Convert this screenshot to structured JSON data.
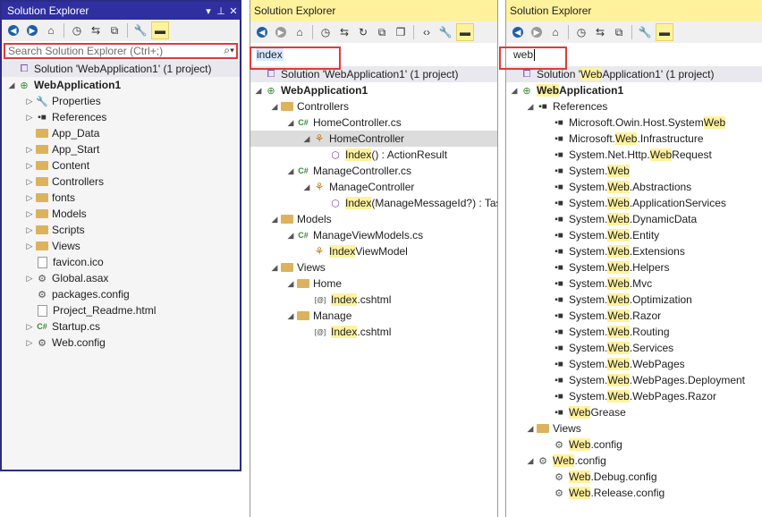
{
  "panel1": {
    "title": "Solution Explorer",
    "title_buttons": [
      "▾",
      "⊥",
      "✕"
    ],
    "search_placeholder": "Search Solution Explorer (Ctrl+;)",
    "rows": [
      {
        "t": "Solution 'WebApplication1' (1 project)",
        "icon": "solution-icon",
        "lvl": 0,
        "tri": ""
      },
      {
        "t": "WebApplication1",
        "icon": "project-icon",
        "lvl": 0,
        "tri": "◢",
        "bold": true
      },
      {
        "t": "Properties",
        "icon": "wrench-icon",
        "lvl": 1,
        "tri": "▷"
      },
      {
        "t": "References",
        "icon": "references-icon",
        "lvl": 1,
        "tri": "▷"
      },
      {
        "t": "App_Data",
        "icon": "folder-icon",
        "lvl": 1,
        "tri": ""
      },
      {
        "t": "App_Start",
        "icon": "folder-icon",
        "lvl": 1,
        "tri": "▷"
      },
      {
        "t": "Content",
        "icon": "folder-icon",
        "lvl": 1,
        "tri": "▷"
      },
      {
        "t": "Controllers",
        "icon": "folder-icon",
        "lvl": 1,
        "tri": "▷"
      },
      {
        "t": "fonts",
        "icon": "folder-icon",
        "lvl": 1,
        "tri": "▷"
      },
      {
        "t": "Models",
        "icon": "folder-icon",
        "lvl": 1,
        "tri": "▷"
      },
      {
        "t": "Scripts",
        "icon": "folder-icon",
        "lvl": 1,
        "tri": "▷"
      },
      {
        "t": "Views",
        "icon": "folder-icon",
        "lvl": 1,
        "tri": "▷"
      },
      {
        "t": "favicon.ico",
        "icon": "file-icon",
        "lvl": 1,
        "tri": ""
      },
      {
        "t": "Global.asax",
        "icon": "config-icon",
        "lvl": 1,
        "tri": "▷"
      },
      {
        "t": "packages.config",
        "icon": "config-icon",
        "lvl": 1,
        "tri": ""
      },
      {
        "t": "Project_Readme.html",
        "icon": "file-icon",
        "lvl": 1,
        "tri": ""
      },
      {
        "t": "Startup.cs",
        "icon": "csharp-icon",
        "lvl": 1,
        "tri": "▷"
      },
      {
        "t": "Web.config",
        "icon": "config-icon",
        "lvl": 1,
        "tri": "▷"
      }
    ]
  },
  "panel2": {
    "title": "Solution Explorer",
    "search_value": "index",
    "rows": [
      {
        "t": "Solution 'WebApplication1' (1 project)",
        "icon": "solution-icon",
        "lvl": 0,
        "tri": ""
      },
      {
        "t": "WebApplication1",
        "icon": "project-icon",
        "lvl": 0,
        "tri": "◢",
        "bold": true
      },
      {
        "t": "Controllers",
        "icon": "folder-icon",
        "lvl": 1,
        "tri": "◢"
      },
      {
        "t": "HomeController.cs",
        "icon": "csharp-icon",
        "lvl": 2,
        "tri": "◢"
      },
      {
        "t": "HomeController",
        "icon": "class-icon",
        "lvl": 3,
        "tri": "◢",
        "hi": true
      },
      {
        "t": "Index() : ActionResult",
        "icon": "method-icon",
        "lvl": 4,
        "tri": "",
        "hl": "Index"
      },
      {
        "t": "ManageController.cs",
        "icon": "csharp-icon",
        "lvl": 2,
        "tri": "◢"
      },
      {
        "t": "ManageController",
        "icon": "class-icon",
        "lvl": 3,
        "tri": "◢"
      },
      {
        "t": "Index(ManageMessageId?) : Task<ActionResult>",
        "icon": "method-icon",
        "lvl": 4,
        "tri": "",
        "hl": "Index"
      },
      {
        "t": "Models",
        "icon": "folder-icon",
        "lvl": 1,
        "tri": "◢"
      },
      {
        "t": "ManageViewModels.cs",
        "icon": "csharp-icon",
        "lvl": 2,
        "tri": "◢"
      },
      {
        "t": "IndexViewModel",
        "icon": "class-icon",
        "lvl": 3,
        "tri": "",
        "hl": "Index"
      },
      {
        "t": "Views",
        "icon": "folder-icon",
        "lvl": 1,
        "tri": "◢"
      },
      {
        "t": "Home",
        "icon": "folder-icon",
        "lvl": 2,
        "tri": "◢"
      },
      {
        "t": "Index.cshtml",
        "icon": "razor-icon",
        "lvl": 3,
        "tri": "",
        "hl": "Index"
      },
      {
        "t": "Manage",
        "icon": "folder-icon",
        "lvl": 2,
        "tri": "◢"
      },
      {
        "t": "Index.cshtml",
        "icon": "razor-icon",
        "lvl": 3,
        "tri": "",
        "hl": "Index"
      }
    ]
  },
  "panel3": {
    "title": "Solution Explorer",
    "search_value": "web",
    "rows": [
      {
        "t": "Solution 'WebApplication1' (1 project)",
        "icon": "solution-icon",
        "lvl": 0,
        "tri": "",
        "hl": "Web"
      },
      {
        "t": "WebApplication1",
        "icon": "project-icon",
        "lvl": 0,
        "tri": "◢",
        "bold": true,
        "hl": "Web"
      },
      {
        "t": "References",
        "icon": "references-icon",
        "lvl": 1,
        "tri": "◢"
      },
      {
        "t": "Microsoft.Owin.Host.SystemWeb",
        "icon": "assembly-icon",
        "lvl": 2,
        "tri": "",
        "hl": "Web"
      },
      {
        "t": "Microsoft.Web.Infrastructure",
        "icon": "assembly-icon",
        "lvl": 2,
        "tri": "",
        "hl": "Web"
      },
      {
        "t": "System.Net.Http.WebRequest",
        "icon": "assembly-icon",
        "lvl": 2,
        "tri": "",
        "hl": "Web"
      },
      {
        "t": "System.Web",
        "icon": "assembly-icon",
        "lvl": 2,
        "tri": "",
        "hl": "Web"
      },
      {
        "t": "System.Web.Abstractions",
        "icon": "assembly-icon",
        "lvl": 2,
        "tri": "",
        "hl": "Web"
      },
      {
        "t": "System.Web.ApplicationServices",
        "icon": "assembly-icon",
        "lvl": 2,
        "tri": "",
        "hl": "Web"
      },
      {
        "t": "System.Web.DynamicData",
        "icon": "assembly-icon",
        "lvl": 2,
        "tri": "",
        "hl": "Web"
      },
      {
        "t": "System.Web.Entity",
        "icon": "assembly-icon",
        "lvl": 2,
        "tri": "",
        "hl": "Web"
      },
      {
        "t": "System.Web.Extensions",
        "icon": "assembly-icon",
        "lvl": 2,
        "tri": "",
        "hl": "Web"
      },
      {
        "t": "System.Web.Helpers",
        "icon": "assembly-icon",
        "lvl": 2,
        "tri": "",
        "hl": "Web"
      },
      {
        "t": "System.Web.Mvc",
        "icon": "assembly-icon",
        "lvl": 2,
        "tri": "",
        "hl": "Web"
      },
      {
        "t": "System.Web.Optimization",
        "icon": "assembly-icon",
        "lvl": 2,
        "tri": "",
        "hl": "Web"
      },
      {
        "t": "System.Web.Razor",
        "icon": "assembly-icon",
        "lvl": 2,
        "tri": "",
        "hl": "Web"
      },
      {
        "t": "System.Web.Routing",
        "icon": "assembly-icon",
        "lvl": 2,
        "tri": "",
        "hl": "Web"
      },
      {
        "t": "System.Web.Services",
        "icon": "assembly-icon",
        "lvl": 2,
        "tri": "",
        "hl": "Web"
      },
      {
        "t": "System.Web.WebPages",
        "icon": "assembly-icon",
        "lvl": 2,
        "tri": "",
        "hl": "Web"
      },
      {
        "t": "System.Web.WebPages.Deployment",
        "icon": "assembly-icon",
        "lvl": 2,
        "tri": "",
        "hl": "Web"
      },
      {
        "t": "System.Web.WebPages.Razor",
        "icon": "assembly-icon",
        "lvl": 2,
        "tri": "",
        "hl": "Web"
      },
      {
        "t": "WebGrease",
        "icon": "assembly-icon",
        "lvl": 2,
        "tri": "",
        "hl": "Web"
      },
      {
        "t": "Views",
        "icon": "folder-icon",
        "lvl": 1,
        "tri": "◢"
      },
      {
        "t": "Web.config",
        "icon": "config-icon",
        "lvl": 2,
        "tri": "",
        "hl": "Web"
      },
      {
        "t": "Web.config",
        "icon": "config-icon",
        "lvl": 1,
        "tri": "◢",
        "hl": "Web"
      },
      {
        "t": "Web.Debug.config",
        "icon": "config-icon",
        "lvl": 2,
        "tri": "",
        "hl": "Web"
      },
      {
        "t": "Web.Release.config",
        "icon": "config-icon",
        "lvl": 2,
        "tri": "",
        "hl": "Web"
      }
    ]
  }
}
